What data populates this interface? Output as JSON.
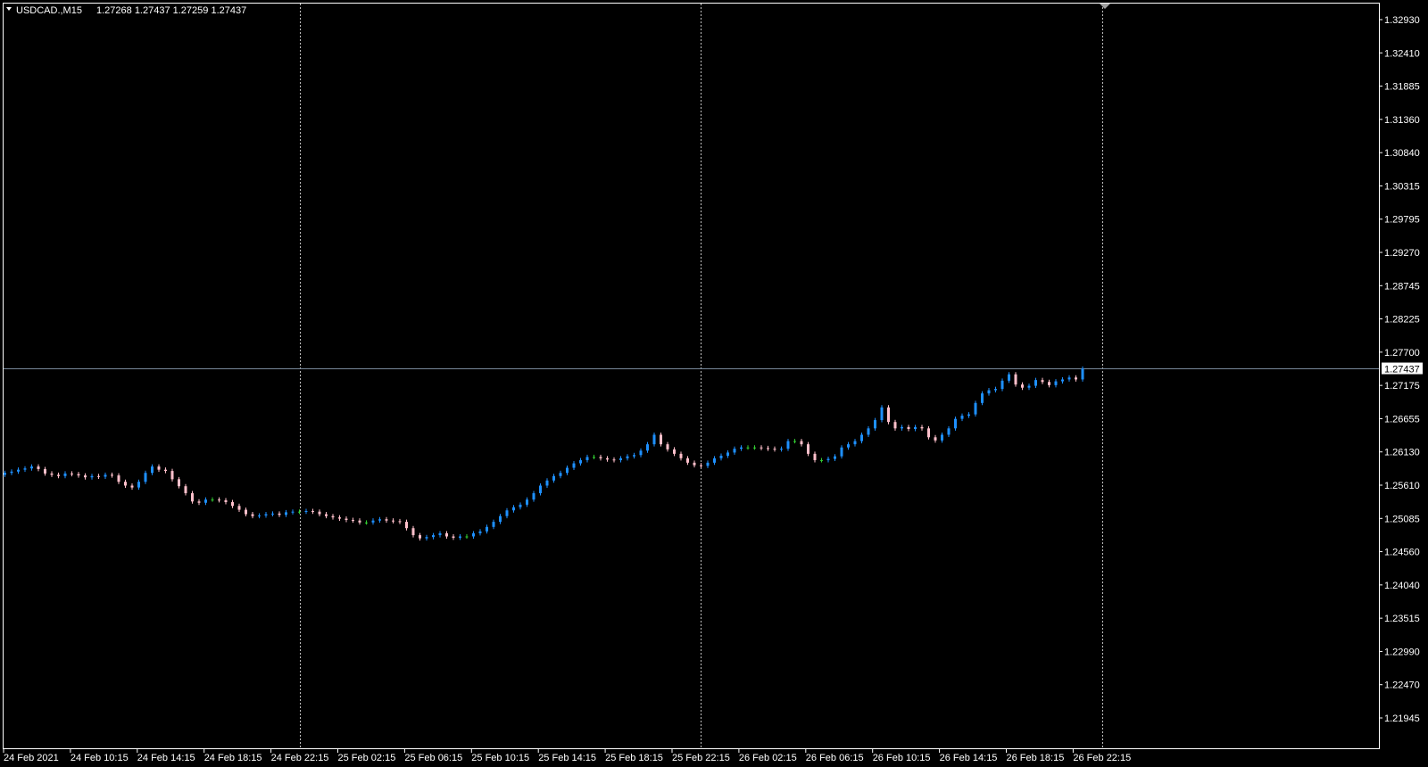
{
  "header": {
    "symbol": "USDCAD.,M15",
    "ohlc": "1.27268 1.27437 1.27259 1.27437"
  },
  "colors": {
    "background": "#000000",
    "frame": "#ffffff",
    "grid": "#c0c0c0",
    "bull": "#1e90ff",
    "bear": "#ffc0cb",
    "doji": "#32cd32",
    "bid_line": "#778899"
  },
  "chart_data": {
    "type": "candlestick",
    "symbol": "USDCAD.",
    "timeframe": "M15",
    "ylim": [
      1.21945,
      1.3293
    ],
    "yticks": [
      "1.32930",
      "1.32410",
      "1.31885",
      "1.31360",
      "1.30840",
      "1.30315",
      "1.29795",
      "1.29270",
      "1.28745",
      "1.28225",
      "1.27700",
      "1.27175",
      "1.26655",
      "1.26130",
      "1.25610",
      "1.25085",
      "1.24560",
      "1.24040",
      "1.23515",
      "1.22990",
      "1.22470",
      "1.21945"
    ],
    "xticks": [
      "24 Feb 2021",
      "24 Feb 10:15",
      "24 Feb 14:15",
      "24 Feb 18:15",
      "24 Feb 22:15",
      "25 Feb 02:15",
      "25 Feb 06:15",
      "25 Feb 10:15",
      "25 Feb 14:15",
      "25 Feb 18:15",
      "25 Feb 22:15",
      "26 Feb 02:15",
      "26 Feb 06:15",
      "26 Feb 10:15",
      "26 Feb 14:15",
      "26 Feb 18:15",
      "26 Feb 22:15"
    ],
    "current_price": "1.27437",
    "grid": "vertical period separators",
    "closes": [
      1.258,
      1.2582,
      1.2585,
      1.2587,
      1.259,
      1.2586,
      1.2579,
      1.2577,
      1.2575,
      1.2579,
      1.2578,
      1.2576,
      1.2573,
      1.2575,
      1.2574,
      1.2577,
      1.2576,
      1.2566,
      1.256,
      1.2557,
      1.2566,
      1.258,
      1.259,
      1.2585,
      1.2583,
      1.257,
      1.2559,
      1.2548,
      1.2535,
      1.2533,
      1.2538,
      1.2538,
      1.2537,
      1.2534,
      1.2528,
      1.2522,
      1.2515,
      1.2512,
      1.2513,
      1.2515,
      1.2516,
      1.2514,
      1.2518,
      1.2519,
      1.2519,
      1.252,
      1.2519,
      1.2515,
      1.2512,
      1.251,
      1.2508,
      1.2506,
      1.2505,
      1.2502,
      1.2502,
      1.2505,
      1.2507,
      1.2505,
      1.2504,
      1.2503,
      1.2493,
      1.2482,
      1.2477,
      1.2479,
      1.2482,
      1.2485,
      1.248,
      1.2478,
      1.248,
      1.248,
      1.2485,
      1.2488,
      1.2495,
      1.2503,
      1.2512,
      1.2521,
      1.2526,
      1.253,
      1.2538,
      1.2548,
      1.256,
      1.2568,
      1.2575,
      1.258,
      1.2588,
      1.2595,
      1.26,
      1.2605,
      1.2605,
      1.2603,
      1.2601,
      1.26,
      1.2603,
      1.2606,
      1.2608,
      1.2615,
      1.2625,
      1.264,
      1.2625,
      1.2617,
      1.261,
      1.2603,
      1.2596,
      1.2592,
      1.2591,
      1.2596,
      1.2603,
      1.2607,
      1.2612,
      1.2618,
      1.262,
      1.262,
      1.262,
      1.2619,
      1.2618,
      1.2617,
      1.2618,
      1.263,
      1.263,
      1.2625,
      1.261,
      1.26,
      1.26,
      1.2602,
      1.2606,
      1.262,
      1.2625,
      1.263,
      1.264,
      1.265,
      1.2663,
      1.2683,
      1.266,
      1.265,
      1.2652,
      1.2649,
      1.2652,
      1.265,
      1.2636,
      1.2631,
      1.264,
      1.265,
      1.2665,
      1.267,
      1.2672,
      1.269,
      1.2705,
      1.271,
      1.2712,
      1.2725,
      1.2735,
      1.2719,
      1.2714,
      1.2717,
      1.2726,
      1.2723,
      1.2718,
      1.2724,
      1.2727,
      1.273,
      1.2727,
      1.2744
    ]
  }
}
